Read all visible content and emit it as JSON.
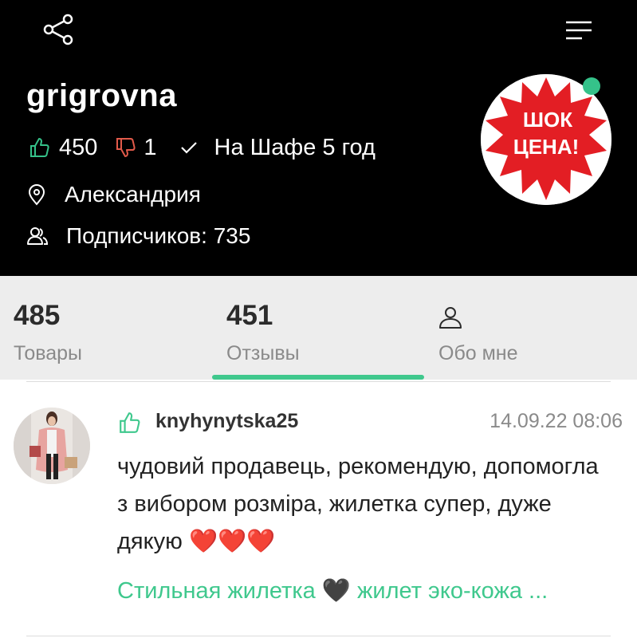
{
  "profile": {
    "username": "grigrovna",
    "likes": "450",
    "dislikes": "1",
    "tenure": "На Шафе 5 год",
    "city": "Александрия",
    "followers": "Подписчиков: 735",
    "avatar_line1": "ШОК",
    "avatar_line2": "ЦЕНА!",
    "online": true
  },
  "tabs": [
    {
      "count": "485",
      "label": "Товары"
    },
    {
      "count": "451",
      "label": "Отзывы",
      "active": true
    },
    {
      "label": "Обо мне",
      "icon": "user-icon"
    }
  ],
  "review": {
    "reviewer": "knyhynytska25",
    "date": "14.09.22 08:06",
    "text": "чудовий продавець, рекомендую, допомогла з вибором розміра, жилетка супер, дуже дякую ❤️❤️❤️",
    "product": "Стильная жилетка 🖤 жилет эко-кожа ..."
  },
  "colors": {
    "accent": "#3fc88d",
    "like": "#35c28a",
    "dislike": "#e25a4a",
    "header_bg": "#000000",
    "tabs_bg": "#ededed"
  },
  "icons": {
    "share": "share-icon",
    "menu": "menu-icon",
    "like": "thumbs-up-icon",
    "dislike": "thumbs-down-icon",
    "check": "check-icon",
    "location": "location-pin-icon",
    "followers": "followers-icon",
    "about": "user-icon"
  }
}
